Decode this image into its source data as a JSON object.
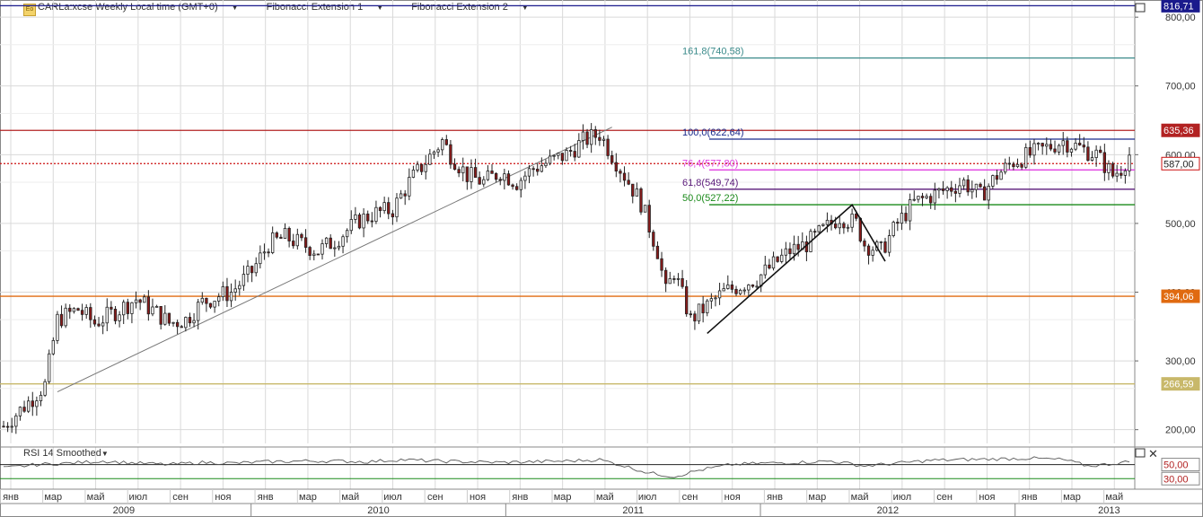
{
  "header": {
    "symbol": "CARLa:xcse Weekly Local time (GMT+0)",
    "fib1": "Fibonacci Extension 1",
    "fib2": "Fibonacci Extension 2",
    "logo": "Eo"
  },
  "rsi": {
    "label": "RSI 14 Smoothed"
  },
  "colors": {
    "grid": "#d9d9d9",
    "bull": "#ffffff",
    "bear": "#8b1a1a",
    "level_top": "#1a1a8c",
    "level_635": "#b22222",
    "level_394": "#e06a10",
    "level_266": "#c8b86a",
    "current": "#cc1111",
    "fib_1618": "#3a8a8a",
    "fib_1000": "#1a2a8c",
    "fib_764": "#e040e0",
    "fib_618": "#5a1a7a",
    "fib_500": "#1a8a1a"
  },
  "chart_data": {
    "type": "candlestick",
    "y_ticks": [
      "800,00",
      "700,00",
      "600,00",
      "500,00",
      "400,00",
      "300,00",
      "200,00"
    ],
    "y_tick_values": [
      800,
      700,
      600,
      500,
      400,
      300,
      200
    ],
    "ylim": [
      180,
      825
    ],
    "levels": [
      {
        "value": 816.71,
        "label": "816,71",
        "color_key": "level_top"
      },
      {
        "value": 635.36,
        "label": "635,36",
        "color_key": "level_635"
      },
      {
        "value": 587.0,
        "label": "587,00",
        "color_key": "current"
      },
      {
        "value": 394.06,
        "label": "394,06",
        "color_key": "level_394"
      },
      {
        "value": 266.59,
        "label": "266,59",
        "color_key": "level_266"
      }
    ],
    "fib_levels": [
      {
        "value": 740.58,
        "label": "161,8(740,58)",
        "color_key": "fib_1618"
      },
      {
        "value": 622.64,
        "label": "100,0(622,64)",
        "color_key": "fib_1000"
      },
      {
        "value": 577.8,
        "label": "76,4(577,80)",
        "color_key": "fib_764"
      },
      {
        "value": 549.74,
        "label": "61,8(549,74)",
        "color_key": "fib_618"
      },
      {
        "value": 527.22,
        "label": "50,0(527,22)",
        "color_key": "fib_500"
      }
    ],
    "month_labels": [
      "янв",
      "мар",
      "май",
      "июл",
      "сен",
      "ноя",
      "янв",
      "мар",
      "май",
      "июл",
      "сен",
      "ноя",
      "янв",
      "мар",
      "май",
      "июл",
      "сен",
      "ноя",
      "янв",
      "мар",
      "май",
      "июл",
      "сен",
      "ноя",
      "янв",
      "мар",
      "май"
    ],
    "years": [
      "2009",
      "2010",
      "2011",
      "2012",
      "2013"
    ],
    "price_path": [
      [
        0,
        205
      ],
      [
        6,
        240
      ],
      [
        10,
        265
      ],
      [
        13,
        360
      ],
      [
        18,
        375
      ],
      [
        22,
        355
      ],
      [
        28,
        375
      ],
      [
        32,
        390
      ],
      [
        37,
        370
      ],
      [
        40,
        355
      ],
      [
        44,
        360
      ],
      [
        48,
        385
      ],
      [
        52,
        395
      ],
      [
        55,
        400
      ],
      [
        60,
        430
      ],
      [
        64,
        470
      ],
      [
        68,
        480
      ],
      [
        72,
        470
      ],
      [
        76,
        460
      ],
      [
        80,
        475
      ],
      [
        86,
        505
      ],
      [
        90,
        515
      ],
      [
        94,
        520
      ],
      [
        98,
        560
      ],
      [
        102,
        590
      ],
      [
        106,
        620
      ],
      [
        108,
        600
      ],
      [
        112,
        570
      ],
      [
        116,
        560
      ],
      [
        120,
        575
      ],
      [
        124,
        560
      ],
      [
        128,
        580
      ],
      [
        132,
        590
      ],
      [
        136,
        600
      ],
      [
        140,
        620
      ],
      [
        144,
        630
      ],
      [
        146,
        610
      ],
      [
        150,
        570
      ],
      [
        154,
        530
      ],
      [
        158,
        460
      ],
      [
        160,
        400
      ],
      [
        162,
        430
      ],
      [
        166,
        360
      ],
      [
        170,
        380
      ],
      [
        174,
        400
      ],
      [
        178,
        410
      ],
      [
        182,
        420
      ],
      [
        186,
        440
      ],
      [
        190,
        460
      ],
      [
        194,
        470
      ],
      [
        198,
        490
      ],
      [
        202,
        510
      ],
      [
        206,
        500
      ],
      [
        208,
        470
      ],
      [
        212,
        460
      ],
      [
        216,
        500
      ],
      [
        220,
        530
      ],
      [
        224,
        540
      ],
      [
        228,
        550
      ],
      [
        232,
        560
      ],
      [
        236,
        540
      ],
      [
        240,
        570
      ],
      [
        244,
        590
      ],
      [
        248,
        600
      ],
      [
        252,
        610
      ],
      [
        256,
        620
      ],
      [
        260,
        610
      ],
      [
        264,
        600
      ],
      [
        268,
        570
      ],
      [
        270,
        580
      ],
      [
        272,
        600
      ]
    ],
    "fib_points": [
      [
        170,
        340
      ],
      [
        205,
        527
      ],
      [
        213,
        445
      ]
    ],
    "trend_points": [
      [
        13,
        255
      ],
      [
        147,
        640
      ]
    ],
    "rsi_ticks": [
      "50,00",
      "30,00"
    ],
    "rsi_tick_values": [
      50,
      30
    ],
    "rsi_path": [
      [
        0,
        45
      ],
      [
        8,
        50
      ],
      [
        16,
        52
      ],
      [
        24,
        55
      ],
      [
        32,
        52
      ],
      [
        40,
        50
      ],
      [
        48,
        53
      ],
      [
        56,
        52
      ],
      [
        64,
        54
      ],
      [
        72,
        55
      ],
      [
        80,
        55
      ],
      [
        88,
        54
      ],
      [
        96,
        57
      ],
      [
        104,
        55
      ],
      [
        112,
        54
      ],
      [
        120,
        53
      ],
      [
        128,
        54
      ],
      [
        136,
        55
      ],
      [
        144,
        57
      ],
      [
        150,
        48
      ],
      [
        156,
        38
      ],
      [
        162,
        33
      ],
      [
        168,
        42
      ],
      [
        176,
        50
      ],
      [
        184,
        52
      ],
      [
        192,
        53
      ],
      [
        200,
        55
      ],
      [
        208,
        48
      ],
      [
        216,
        52
      ],
      [
        224,
        56
      ],
      [
        232,
        57
      ],
      [
        240,
        58
      ],
      [
        248,
        59
      ],
      [
        256,
        57
      ],
      [
        262,
        48
      ],
      [
        266,
        50
      ],
      [
        272,
        54
      ]
    ]
  }
}
